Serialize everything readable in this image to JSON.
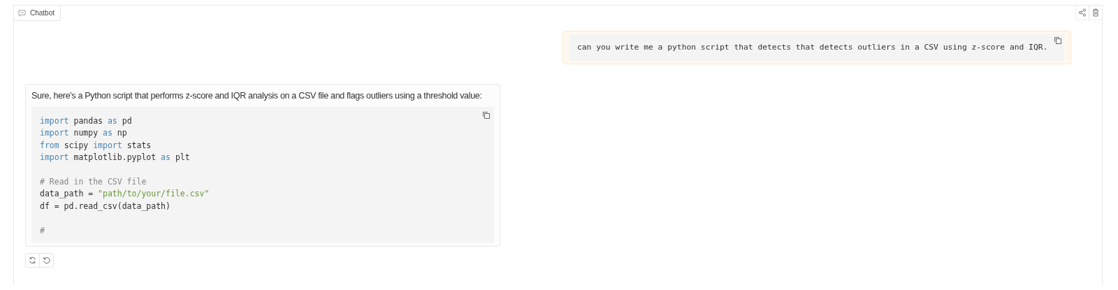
{
  "panel": {
    "label": "Chatbot"
  },
  "messages": [
    {
      "kind": "user",
      "text": "can you write me a python script that detects that detects outliers in a CSV using z-score and IQR."
    },
    {
      "kind": "bot",
      "text": "Sure, here's a Python script that performs z-score and IQR analysis on a CSV file and flags outliers using a threshold value:",
      "code": [
        {
          "kind": "code",
          "tokens": [
            {
              "kind": "kw",
              "text": "import"
            },
            {
              "kind": "plain",
              "text": " pandas "
            },
            {
              "kind": "kw",
              "text": "as"
            },
            {
              "kind": "plain",
              "text": " pd"
            }
          ]
        },
        {
          "kind": "code",
          "tokens": [
            {
              "kind": "kw",
              "text": "import"
            },
            {
              "kind": "plain",
              "text": " numpy "
            },
            {
              "kind": "kw",
              "text": "as"
            },
            {
              "kind": "plain",
              "text": " np"
            }
          ]
        },
        {
          "kind": "code",
          "tokens": [
            {
              "kind": "kw",
              "text": "from"
            },
            {
              "kind": "plain",
              "text": " scipy "
            },
            {
              "kind": "kw",
              "text": "import"
            },
            {
              "kind": "plain",
              "text": " stats"
            }
          ]
        },
        {
          "kind": "code",
          "tokens": [
            {
              "kind": "kw",
              "text": "import"
            },
            {
              "kind": "plain",
              "text": " matplotlib.pyplot "
            },
            {
              "kind": "kw",
              "text": "as"
            },
            {
              "kind": "plain",
              "text": " plt"
            }
          ]
        },
        {
          "kind": "blank"
        },
        {
          "kind": "code",
          "tokens": [
            {
              "kind": "comment",
              "text": "# Read in the CSV file"
            }
          ]
        },
        {
          "kind": "code",
          "tokens": [
            {
              "kind": "plain",
              "text": "data_path = "
            },
            {
              "kind": "str",
              "text": "\"path/to/your/file.csv\""
            }
          ]
        },
        {
          "kind": "code",
          "tokens": [
            {
              "kind": "plain",
              "text": "df = pd.read_csv(data_path)"
            }
          ]
        },
        {
          "kind": "blank"
        },
        {
          "kind": "code",
          "tokens": [
            {
              "kind": "comment",
              "text": "#"
            }
          ]
        }
      ]
    }
  ]
}
